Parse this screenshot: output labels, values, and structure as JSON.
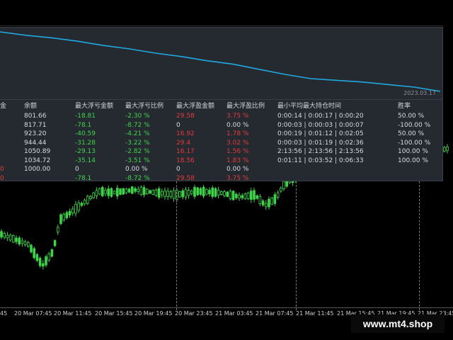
{
  "equity": {
    "date_label": "2023.03.17",
    "line_color": "#1fa9e0",
    "points": [
      1.0,
      0.96,
      0.93,
      0.89,
      0.84,
      0.8,
      0.75,
      0.71,
      0.66,
      0.62,
      0.56,
      0.5,
      0.45,
      0.43,
      0.41,
      0.38,
      0.35,
      0.3
    ]
  },
  "table": {
    "headers": [
      "金",
      "余额",
      "最大浮亏金额",
      "最大浮亏比例",
      "最大浮盈金额",
      "最大浮盈比例",
      "最小平均最大持仓时间",
      "胜率"
    ],
    "rows": [
      {
        "c0": "",
        "balance": "801.66",
        "max_loss_amt": "-18.81",
        "max_loss_pct": "-2.30 %",
        "max_profit_amt": "29.58",
        "max_profit_pct": "3.75 %",
        "hold_time": "0:00:14 | 0:00:17 | 0:00:20",
        "win_rate": "50.00 %"
      },
      {
        "c0": "",
        "balance": "817.71",
        "max_loss_amt": "-78.1",
        "max_loss_pct": "-8.72 %",
        "max_profit_amt": "0",
        "max_profit_pct": "0.00 %",
        "hold_time": "0:00:03 | 0:00:03 | 0:00:07",
        "win_rate": "-100.00 %"
      },
      {
        "c0": "",
        "balance": "923.20",
        "max_loss_amt": "-40.59",
        "max_loss_pct": "-4.21 %",
        "max_profit_amt": "16.92",
        "max_profit_pct": "1.78 %",
        "hold_time": "0:00:19 | 0:01:12 | 0:02:05",
        "win_rate": "50.00 %"
      },
      {
        "c0": "",
        "balance": "944.44",
        "max_loss_amt": "-31.28",
        "max_loss_pct": "-3.22 %",
        "max_profit_amt": "29.4",
        "max_profit_pct": "3.02 %",
        "hold_time": "0:00:03 | 0:01:19 | 0:02:36",
        "win_rate": "-100.00 %"
      },
      {
        "c0": "",
        "balance": "1050.89",
        "max_loss_amt": "-29.13",
        "max_loss_pct": "-2.82 %",
        "max_profit_amt": "16.17",
        "max_profit_pct": "1.56 %",
        "hold_time": "2:13:56 | 2:13:56 | 2:13:56",
        "win_rate": "100.00 %"
      },
      {
        "c0": "",
        "balance": "1034.72",
        "max_loss_amt": "-35.14",
        "max_loss_pct": "-3.51 %",
        "max_profit_amt": "18.56",
        "max_profit_pct": "1.83 %",
        "hold_time": "0:01:11 | 0:03:52 | 0:06:33",
        "win_rate": "100.00 %"
      },
      {
        "c0": "0",
        "balance": "1000.00",
        "max_loss_amt": "0",
        "max_loss_pct": "0.00 %",
        "max_profit_amt": "0",
        "max_profit_pct": "0.00 %",
        "hold_time": "",
        "win_rate": ""
      },
      {
        "c0": "0",
        "balance": "",
        "max_loss_amt": "-78.1",
        "max_loss_pct": "-8.72 %",
        "max_profit_amt": "29.58",
        "max_profit_pct": "3.75 %",
        "hold_time": "",
        "win_rate": ""
      }
    ]
  },
  "time_axis": [
    "45",
    "20 Mar 07:45",
    "20 Mar 11:45",
    "20 Mar 15:45",
    "20 Mar 19:45",
    "20 Mar 23:45",
    "21 Mar 03:45",
    "21 Mar 07:45",
    "21 Mar 11:45",
    "21 Mar 15:45",
    "21 Mar 19:45",
    "21 Mar 23:45"
  ],
  "colors": {
    "bull_candle": "#3fd34a",
    "bear_candle": "#3fd34a",
    "loss_text": "#3fd34a",
    "profit_text": "#e23a3a",
    "panel_bg": "#252a31"
  },
  "watermark": "www.mt4.shop"
}
